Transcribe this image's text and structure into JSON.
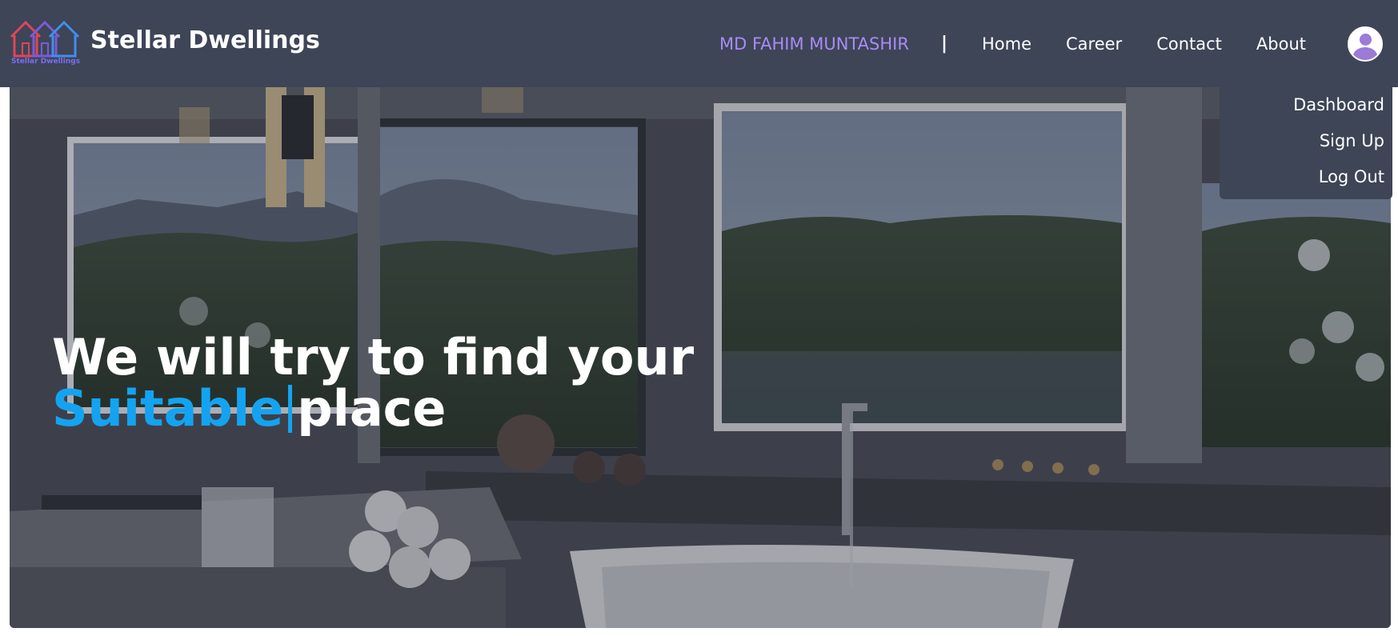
{
  "brand": {
    "logo_text": "Stellar Dwellings",
    "name": "Stellar Dwellings",
    "logo_colors": [
      "#e0455a",
      "#6b5bd6",
      "#3f8ff0"
    ]
  },
  "nav": {
    "user_name": "MD FAHIM MUNTASHIR",
    "separator": "|",
    "links": [
      "Home",
      "Career",
      "Contact",
      "About"
    ],
    "avatar_icon": "user-avatar-icon"
  },
  "dropdown": {
    "items": [
      "Dashboard",
      "Sign Up",
      "Log Out"
    ]
  },
  "hero": {
    "line1": "We will try to find your",
    "typed_word": "Suitable",
    "line2_rest": "place",
    "accent_color": "#14a3f0"
  }
}
